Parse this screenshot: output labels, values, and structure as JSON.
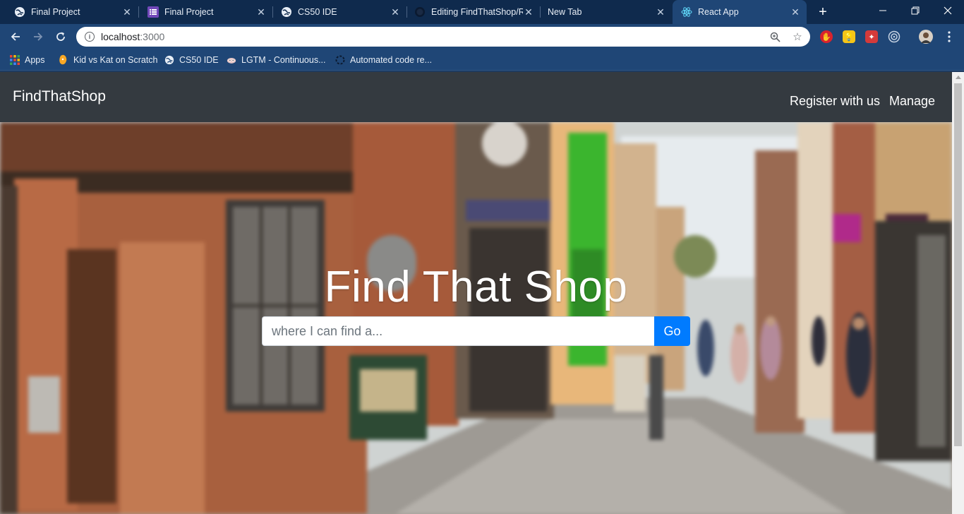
{
  "browser": {
    "tabs": [
      {
        "title": "Final Project",
        "icon": "globe-icon"
      },
      {
        "title": "Final Project",
        "icon": "list-icon"
      },
      {
        "title": "CS50 IDE",
        "icon": "globe-icon"
      },
      {
        "title": "Editing FindThatShop/README.md",
        "icon": "github-icon"
      },
      {
        "title": "New Tab",
        "icon": ""
      },
      {
        "title": "React App",
        "icon": "react-icon",
        "active": true
      }
    ],
    "new_tab_label": "+",
    "window_controls": {
      "minimize": "—",
      "restore": "❐",
      "close": "✕"
    },
    "url_host": "localhost",
    "url_port": ":3000",
    "bookmarks": [
      {
        "label": "Apps",
        "icon": "apps-grid-icon"
      },
      {
        "label": "Kid vs Kat on Scratch",
        "icon": "scratch-icon"
      },
      {
        "label": "CS50 IDE",
        "icon": "globe-icon"
      },
      {
        "label": "LGTM - Continuous...",
        "icon": "lgtm-icon"
      },
      {
        "label": "Automated code re...",
        "icon": "code-review-icon"
      }
    ]
  },
  "app": {
    "brand": "FindThatShop",
    "nav": {
      "register": "Register with us",
      "manage": "Manage"
    },
    "hero": {
      "title": "Find That Shop",
      "search_placeholder": "where I can find a...",
      "search_value": "",
      "search_button": "Go"
    }
  },
  "colors": {
    "tabstrip": "#0f2a4d",
    "toolbar": "#1f4676",
    "navbar": "#343a40",
    "primary_button": "#007bff"
  }
}
